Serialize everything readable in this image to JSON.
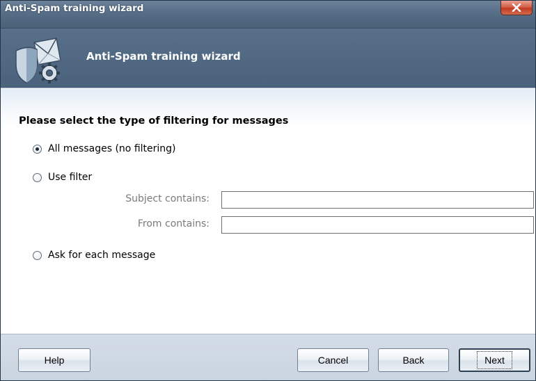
{
  "window": {
    "title": "Anti-Spam training wizard",
    "close_glyph": "X"
  },
  "banner": {
    "title": "Anti-Spam training wizard",
    "icon": "shield-envelope-gear-icon"
  },
  "content": {
    "heading": "Please select the type of filtering for messages",
    "options": [
      {
        "label": "All messages (no filtering)",
        "checked": true
      },
      {
        "label": "Use filter",
        "checked": false
      },
      {
        "label": "Ask for each message",
        "checked": false
      }
    ],
    "filter": {
      "subject_label": "Subject contains:",
      "subject_value": "",
      "from_label": "From contains:",
      "from_value": ""
    }
  },
  "buttons": {
    "help": "Help",
    "cancel": "Cancel",
    "back": "Back",
    "next": "Next"
  },
  "colors": {
    "titlebar": "#566e86",
    "banner": "#4a627b",
    "footer": "#cad4df",
    "close": "#c23a22"
  }
}
